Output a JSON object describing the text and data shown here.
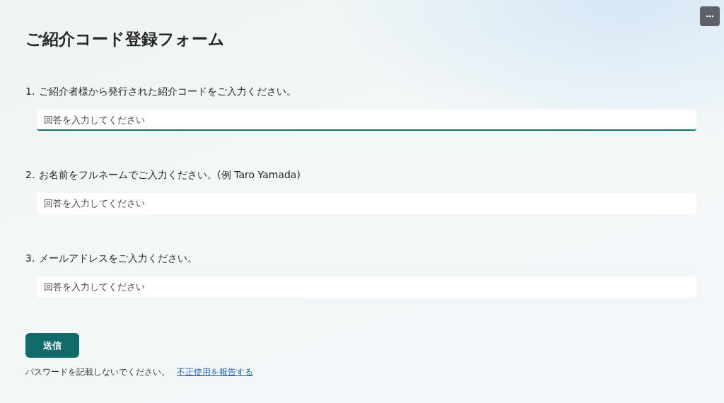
{
  "title": "ご紹介コード登録フォーム",
  "questions": [
    {
      "number": "1.",
      "text": "ご紹介者様から発行された紹介コードをご入力ください。",
      "placeholder": "回答を入力してください",
      "focused": true
    },
    {
      "number": "2.",
      "text": "お名前をフルネームでご入力ください。(例 Taro Yamada)",
      "placeholder": "回答を入力してください",
      "focused": false
    },
    {
      "number": "3.",
      "text": "メールアドレスをご入力ください。",
      "placeholder": "回答を入力してください",
      "focused": false
    }
  ],
  "submit": "送信",
  "footer": {
    "note": "パスワードを記載しないでください。",
    "link": "不正使用を報告する"
  }
}
